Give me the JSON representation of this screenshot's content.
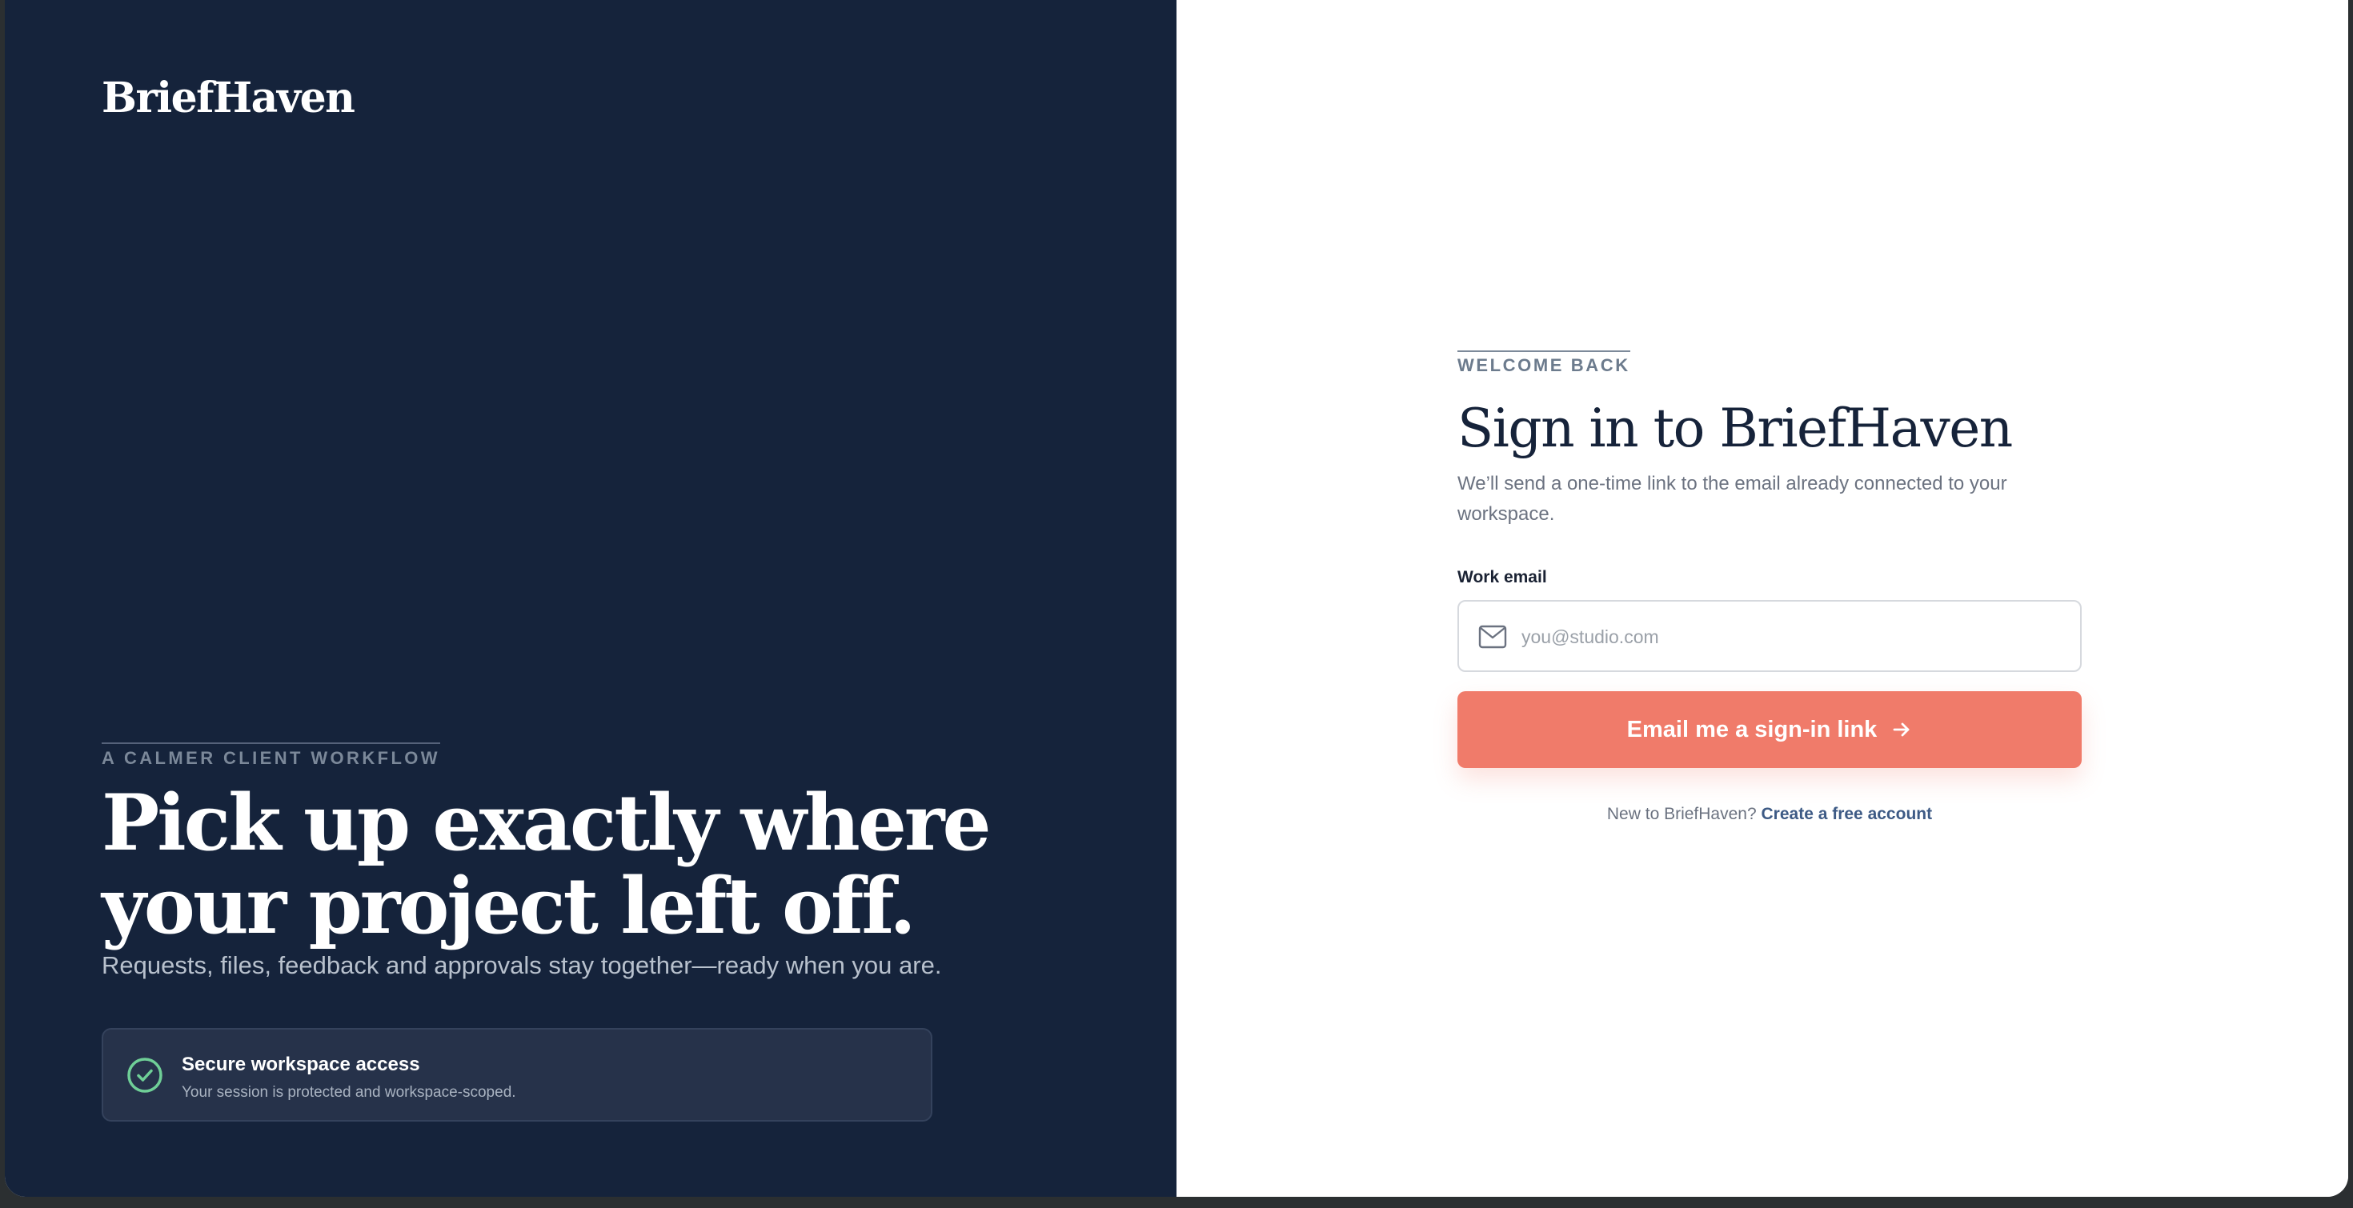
{
  "brand": {
    "name": "BriefHaven"
  },
  "hero": {
    "eyebrow": "A CALMER CLIENT WORKFLOW",
    "headline_line1": "Pick up exactly where",
    "headline_line2": "your project left off.",
    "subhead": "Requests, files, feedback and approvals stay together—ready when you are."
  },
  "secure": {
    "title": "Secure workspace access",
    "subtitle": "Your session is protected and workspace-scoped.",
    "icon": "check-circle-icon"
  },
  "signin": {
    "eyebrow": "WELCOME BACK",
    "title": "Sign in to BriefHaven",
    "description": "We’ll send a one-time link to the email already connected to your workspace.",
    "email_label": "Work email",
    "email_placeholder": "you@studio.com",
    "email_value": "",
    "submit_label": "Email me a sign-in link",
    "signup_prompt": "New to BriefHaven?",
    "signup_link": "Create a free account"
  },
  "colors": {
    "panel_dark": "#15233b",
    "accent": "#f07b6a",
    "success": "#6fcf97",
    "link": "#3d5a85"
  }
}
